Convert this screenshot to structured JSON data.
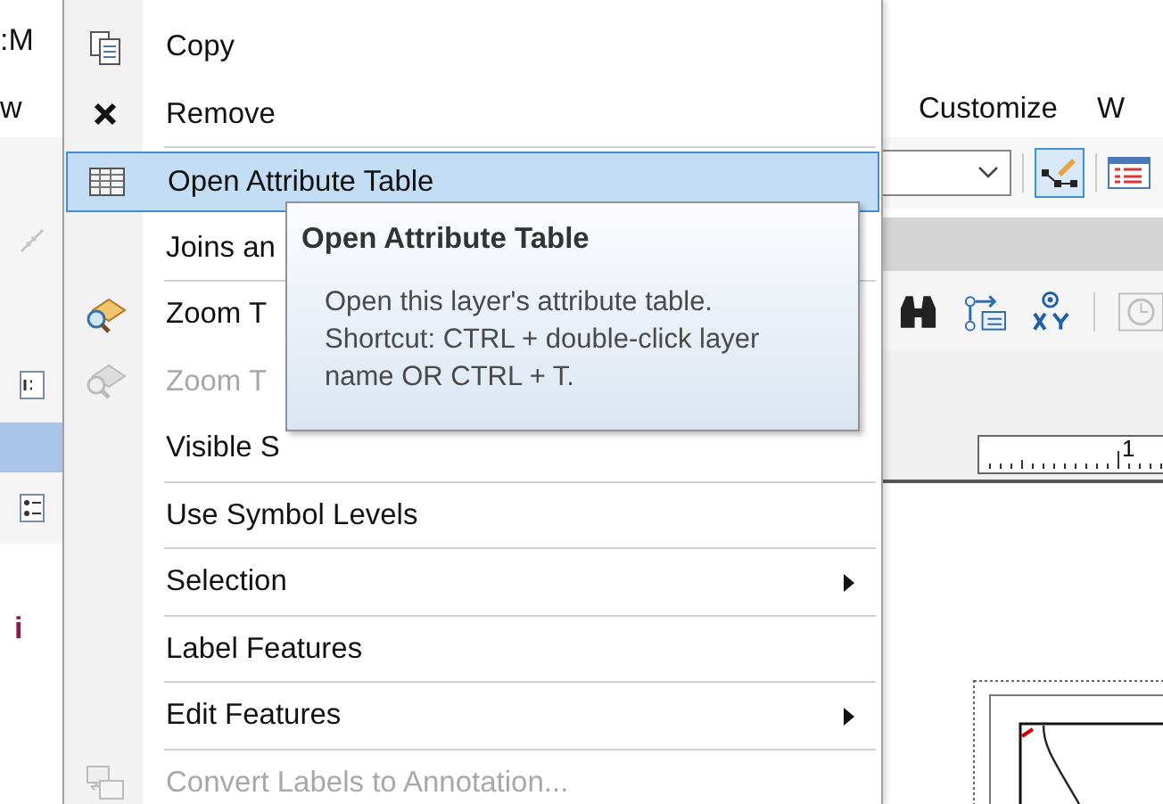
{
  "background": {
    "title_fragment": ":M",
    "menu_fragment": "w",
    "menu_items": [
      "Customize",
      "W"
    ],
    "ruler_label": "1",
    "toc_fragment": "i"
  },
  "context_menu": {
    "items": [
      {
        "label": "Copy",
        "disabled": false,
        "selected": false,
        "submenu": false,
        "separator_after": false
      },
      {
        "label": "Remove",
        "disabled": false,
        "selected": false,
        "submenu": false,
        "separator_after": true
      },
      {
        "label": "Open Attribute Table",
        "disabled": false,
        "selected": true,
        "submenu": false,
        "separator_after": false
      },
      {
        "label": "Joins an",
        "disabled": false,
        "selected": false,
        "separator_after": true
      },
      {
        "label": "Zoom T",
        "disabled": false,
        "selected": false,
        "separator_after": false
      },
      {
        "label": "Zoom T",
        "disabled": true,
        "selected": false,
        "separator_after": false
      },
      {
        "label": "Visible S",
        "disabled": false,
        "selected": false,
        "separator_after": true
      },
      {
        "label": "Use Symbol Levels",
        "disabled": false,
        "selected": false,
        "submenu": false,
        "separator_after": true
      },
      {
        "label": "Selection",
        "disabled": false,
        "selected": false,
        "submenu": true,
        "separator_after": true
      },
      {
        "label": "Label Features",
        "disabled": false,
        "selected": false,
        "submenu": false,
        "separator_after": true
      },
      {
        "label": "Edit Features",
        "disabled": false,
        "selected": false,
        "submenu": true,
        "separator_after": true
      },
      {
        "label": "Convert Labels to Annotation...",
        "disabled": true,
        "selected": false,
        "submenu": false,
        "separator_after": false
      }
    ]
  },
  "tooltip": {
    "title": "Open Attribute Table",
    "text": "Open this layer's attribute table. Shortcut: CTRL + double-click layer name OR CTRL + T."
  }
}
